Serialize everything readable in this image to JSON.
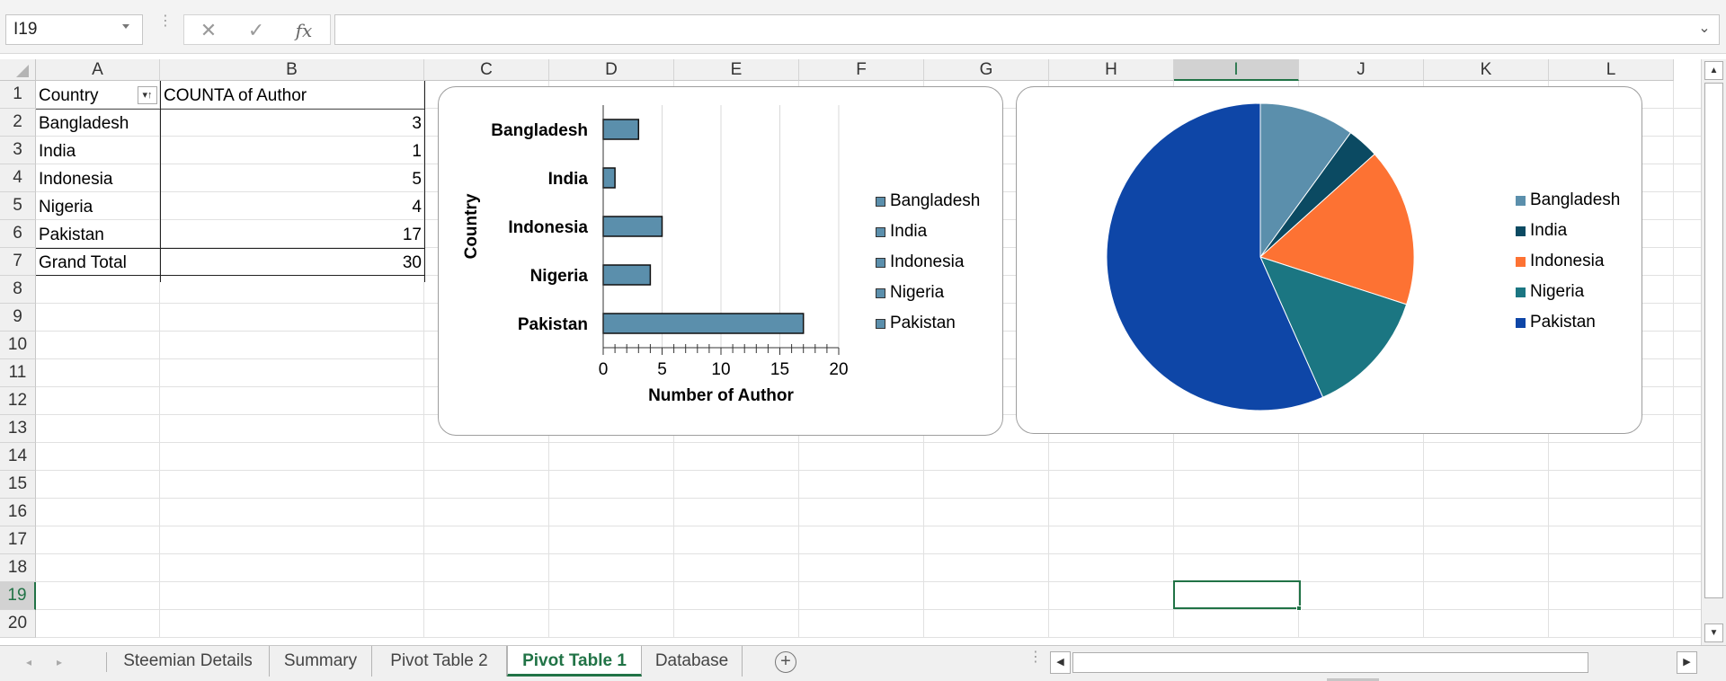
{
  "formula_bar": {
    "name_box": "I19",
    "cancel_symbol": "✕",
    "enter_symbol": "✓",
    "fx_symbol": "fx",
    "formula_value": "",
    "expand_symbol": "⌄",
    "dots": "⋮"
  },
  "columns": [
    "A",
    "B",
    "C",
    "D",
    "E",
    "F",
    "G",
    "H",
    "I",
    "J",
    "K",
    "L"
  ],
  "selected_column": "I",
  "rows": [
    "1",
    "2",
    "3",
    "4",
    "5",
    "6",
    "7",
    "8",
    "9",
    "10",
    "11",
    "12",
    "13",
    "14",
    "15",
    "16",
    "17",
    "18",
    "19",
    "20"
  ],
  "selected_row": "19",
  "pivot": {
    "header_country": "Country",
    "header_count": "COUNTA of Author",
    "filter_symbol": "▾↑",
    "rows": [
      {
        "country": "Bangladesh",
        "count": "3"
      },
      {
        "country": "India",
        "count": "1"
      },
      {
        "country": "Indonesia",
        "count": "5"
      },
      {
        "country": "Nigeria",
        "count": "4"
      },
      {
        "country": "Pakistan",
        "count": "17"
      }
    ],
    "total_label": "Grand Total",
    "total_value": "30"
  },
  "chart_data": [
    {
      "type": "bar",
      "orientation": "horizontal",
      "title": "",
      "categories": [
        "Bangladesh",
        "India",
        "Indonesia",
        "Nigeria",
        "Pakistan"
      ],
      "values": [
        3,
        1,
        5,
        4,
        17
      ],
      "xlabel": "Number of Author",
      "ylabel": "Country",
      "xlim": [
        0,
        20
      ],
      "xticks": [
        "0",
        "5",
        "10",
        "15",
        "20"
      ],
      "grid": true,
      "bar_color": "#5b8fac",
      "legend_position": "right",
      "legend": [
        "Bangladesh",
        "India",
        "Indonesia",
        "Nigeria",
        "Pakistan"
      ]
    },
    {
      "type": "pie",
      "title": "",
      "labels": [
        "Bangladesh",
        "India",
        "Indonesia",
        "Nigeria",
        "Pakistan"
      ],
      "values": [
        3,
        1,
        5,
        4,
        17
      ],
      "colors": [
        "#5b8fac",
        "#0b4a62",
        "#fd7233",
        "#1b7682",
        "#0e46a7"
      ],
      "legend_position": "right",
      "legend": [
        "Bangladesh",
        "India",
        "Indonesia",
        "Nigeria",
        "Pakistan"
      ]
    }
  ],
  "sheet_tabs": {
    "tabs": [
      "Steemian Details",
      "Summary",
      "Pivot Table 2",
      "Pivot Table 1",
      "Database"
    ],
    "active_tab": "Pivot Table 1",
    "add_symbol": "+",
    "prev_symbol": "◂",
    "next_symbol": "▸"
  },
  "scrollbars": {
    "up_symbol": "▲",
    "down_symbol": "▼",
    "left_symbol": "◀",
    "right_symbol": "▶"
  },
  "colors": {
    "accent": "#217346",
    "header_bg": "#f0f0f0",
    "gridline": "#e1e1e1"
  }
}
